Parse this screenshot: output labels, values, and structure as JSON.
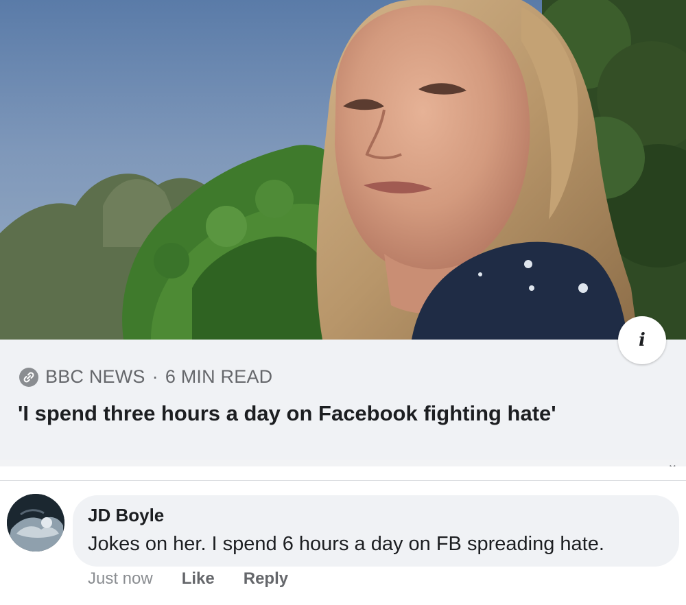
{
  "post": {
    "image_alt": "Woman with shoulder-length blonde hair standing outdoors in front of green trees under a blue sky",
    "info_icon": "info-icon",
    "info_label": "i"
  },
  "link_preview": {
    "source_icon": "link-icon",
    "source": "BBC NEWS",
    "separator": "·",
    "read_time": "6 MIN READ",
    "headline": "'I spend three hours a day on Facebook fighting hate'"
  },
  "comment": {
    "author": "JD Boyle",
    "text": "Jokes on her. I spend 6 hours a day on FB spreading hate.",
    "timestamp": "Just now",
    "like_label": "Like",
    "reply_label": "Reply"
  },
  "colors": {
    "card_background": "#f0f2f5",
    "primary_text": "#1c1e21",
    "secondary_text": "#65676b"
  }
}
